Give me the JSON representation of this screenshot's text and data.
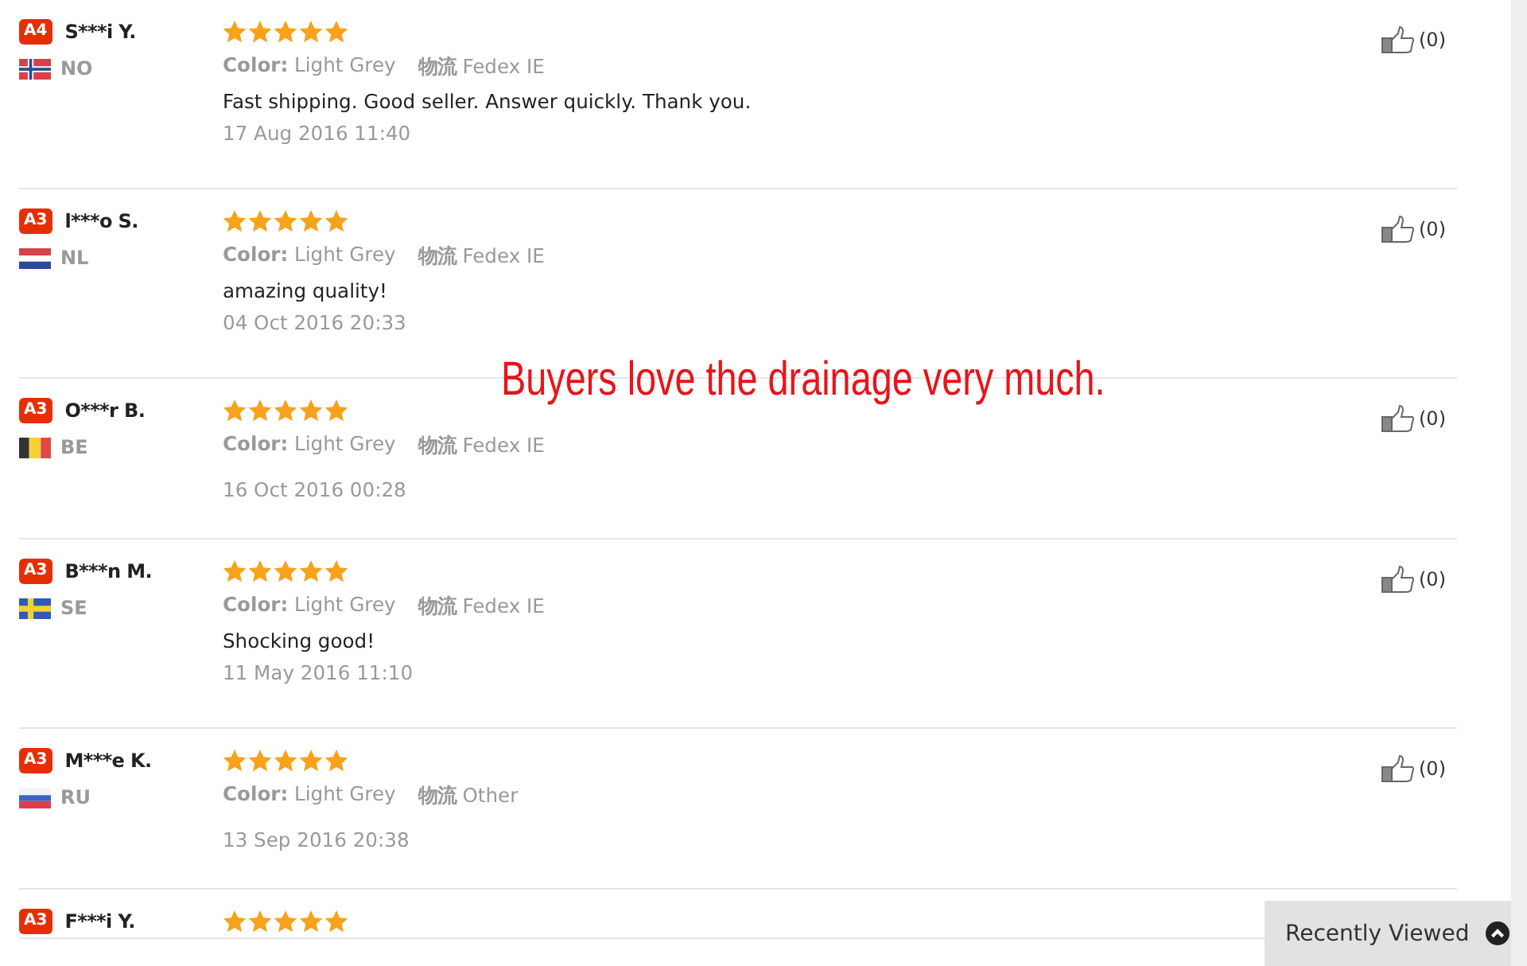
{
  "reviews": [
    {
      "level": "A4",
      "name": "S***i Y.",
      "country": "NO",
      "stars": 5,
      "color_label": "Color:",
      "color_value": "Light Grey",
      "logistics_label": "物流",
      "logistics_value": "Fedex IE",
      "comment": "Fast shipping. Good seller. Answer quickly. Thank you.",
      "date": "17 Aug 2016 11:40",
      "helpful": "(0)"
    },
    {
      "level": "A3",
      "name": "l***o S.",
      "country": "NL",
      "stars": 5,
      "color_label": "Color:",
      "color_value": "Light Grey",
      "logistics_label": "物流",
      "logistics_value": "Fedex IE",
      "comment": "amazing quality!",
      "date": "04 Oct 2016 20:33",
      "helpful": "(0)"
    },
    {
      "level": "A3",
      "name": "O***r B.",
      "country": "BE",
      "stars": 5,
      "color_label": "Color:",
      "color_value": "Light Grey",
      "logistics_label": "物流",
      "logistics_value": "Fedex IE",
      "date": "16 Oct 2016 00:28",
      "helpful": "(0)"
    },
    {
      "level": "A3",
      "name": "B***n M.",
      "country": "SE",
      "stars": 5,
      "color_label": "Color:",
      "color_value": "Light Grey",
      "logistics_label": "物流",
      "logistics_value": "Fedex IE",
      "comment": "Shocking good!",
      "date": "11 May 2016 11:10",
      "helpful": "(0)"
    },
    {
      "level": "A3",
      "name": "M***e K.",
      "country": "RU",
      "stars": 5,
      "color_label": "Color:",
      "color_value": "Light Grey",
      "logistics_label": "物流",
      "logistics_value": "Other",
      "date": "13 Sep 2016 20:38",
      "helpful": "(0)"
    },
    {
      "level": "A3",
      "name": "F***i Y.",
      "stars": 5
    }
  ],
  "overlay_caption": "Buyers love the drainage very much.",
  "recently_viewed": {
    "label": "Recently Viewed"
  }
}
